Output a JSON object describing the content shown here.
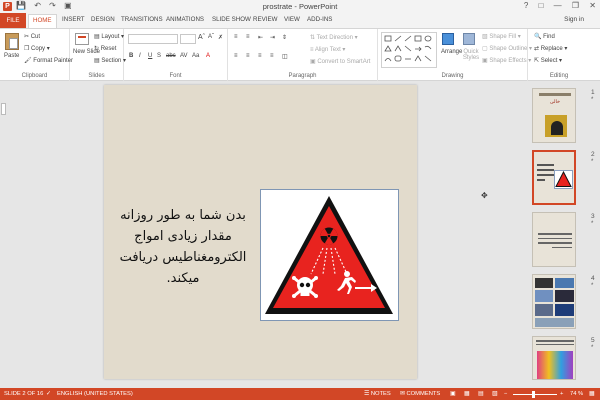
{
  "window": {
    "title": "prostrate - PowerPoint",
    "qat_items": [
      "save",
      "undo",
      "redo",
      "start"
    ],
    "controls": [
      "?",
      "minimize",
      "restore",
      "close"
    ]
  },
  "tabs": [
    "FILE",
    "HOME",
    "INSERT",
    "DESIGN",
    "TRANSITIONS",
    "ANIMATIONS",
    "SLIDE SHOW",
    "REVIEW",
    "VIEW",
    "ADD-INS"
  ],
  "signin": "Sign in",
  "ribbon": {
    "clipboard": {
      "label": "Clipboard",
      "paste": "Paste",
      "cut": "Cut",
      "copy": "Copy",
      "format_painter": "Format Painter"
    },
    "slides": {
      "label": "Slides",
      "new_slide": "New Slide",
      "layout": "Layout",
      "reset": "Reset",
      "section": "Section"
    },
    "font": {
      "label": "Font"
    },
    "paragraph": {
      "label": "Paragraph",
      "text_direction": "Text Direction",
      "align_text": "Align Text",
      "convert_smartart": "Convert to SmartArt"
    },
    "drawing": {
      "label": "Drawing",
      "arrange": "Arrange",
      "quick_styles": "Quick Styles",
      "shape_fill": "Shape Fill",
      "shape_outline": "Shape Outline",
      "shape_effects": "Shape Effects"
    },
    "editing": {
      "label": "Editing",
      "find": "Find",
      "replace": "Replace",
      "select": "Select"
    }
  },
  "slide": {
    "text_lines": [
      "بدن شما به طور روزانه",
      "مقدار زیادی امواج",
      "الکترومغناطیس دریافت",
      "میکند."
    ]
  },
  "thumbnails": [
    {
      "number": "1",
      "star": "*",
      "text": "خالی"
    },
    {
      "number": "2",
      "star": "*"
    },
    {
      "number": "3",
      "star": "*"
    },
    {
      "number": "4",
      "star": "*"
    },
    {
      "number": "5",
      "star": "*"
    }
  ],
  "status": {
    "slide": "SLIDE 2 OF 16",
    "language": "ENGLISH (UNITED STATES)",
    "notes": "NOTES",
    "comments": "COMMENTS",
    "zoom": "74 %"
  },
  "colors": {
    "accent": "#d24726",
    "slide_bg": "#e2dbcc",
    "warning_red": "#e8231f"
  }
}
